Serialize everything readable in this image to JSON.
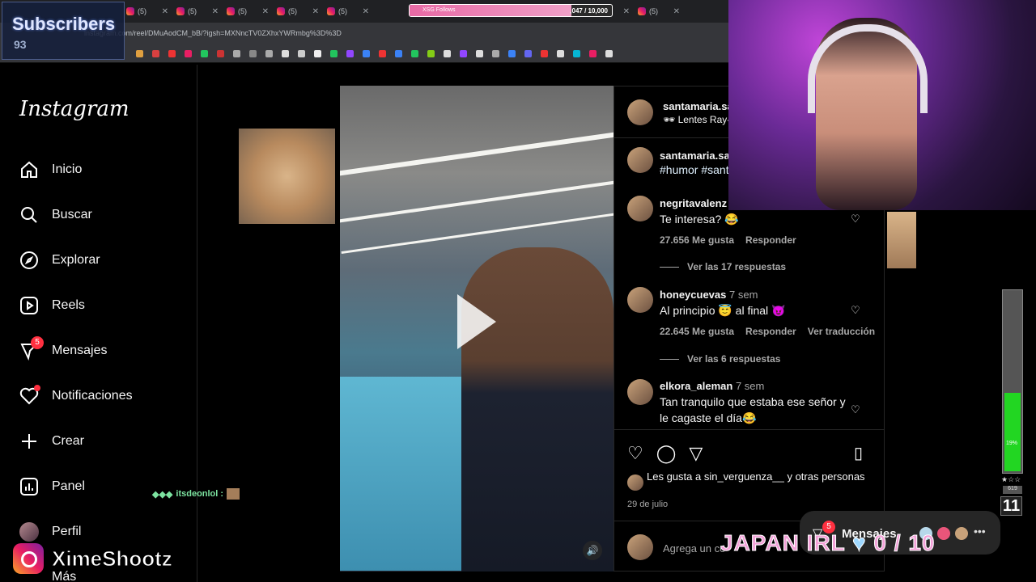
{
  "browser": {
    "tab_label": "(5)",
    "url": "instagram.com/reel/DMuAodCM_bB/?igsh=MXNncTV0ZXhxYWRmbg%3D%3D",
    "xsg_label": "XSG Follows",
    "xsg_count": ",047 / 10,000"
  },
  "overlay": {
    "subscribers_title": "Subscribers",
    "subscribers_count": "93",
    "chat_user": "itsdeonlol :",
    "japan_text": "JAPAN IRL",
    "japan_progress": "0 / 10",
    "brand_name": "XimeShootz",
    "meter_percent": "19%",
    "meter_level_small": "619",
    "meter_level_big": "11",
    "stars": "★☆☆"
  },
  "sidebar": {
    "logo": "Instagram",
    "items": [
      {
        "label": "Inicio",
        "icon": "home-icon"
      },
      {
        "label": "Buscar",
        "icon": "search-icon"
      },
      {
        "label": "Explorar",
        "icon": "compass-icon"
      },
      {
        "label": "Reels",
        "icon": "reels-icon"
      },
      {
        "label": "Mensajes",
        "icon": "messenger-icon",
        "badge": "5"
      },
      {
        "label": "Notificaciones",
        "icon": "heart-icon"
      },
      {
        "label": "Crear",
        "icon": "plus-icon"
      },
      {
        "label": "Panel",
        "icon": "dashboard-icon"
      },
      {
        "label": "Perfil",
        "icon": "profile-avatar"
      },
      {
        "label": "Más",
        "icon": "menu-icon"
      }
    ]
  },
  "post": {
    "author": "santamaria.sa",
    "author_sub": "🕶 Lentes Ray-B",
    "caption_author": "santamaria.sa",
    "caption_tags": "#humor #sant",
    "comments": [
      {
        "user": "negritavalenz",
        "time": "",
        "text": "Te interesa? 😂",
        "likes": "27.656 Me gusta",
        "reply": "Responder",
        "translate": "",
        "replies": "Ver las 17 respuestas"
      },
      {
        "user": "honeycuevas",
        "time": "7 sem",
        "text": "Al principio 😇 al final 😈",
        "likes": "22.645 Me gusta",
        "reply": "Responder",
        "translate": "Ver traducción",
        "replies": "Ver las 6 respuestas"
      },
      {
        "user": "elkora_aleman",
        "time": "7 sem",
        "text": "Tan tranquilo que estaba ese señor y le cagaste el día😂",
        "likes": "",
        "reply": "",
        "translate": "",
        "replies": ""
      }
    ],
    "likes_text": "Les gusta a sin_verguenza__ y otras personas",
    "date": "29 de julio",
    "add_comment_placeholder": "Agrega un co"
  },
  "messages_pill": {
    "label": "Mensajes",
    "badge": "5"
  }
}
